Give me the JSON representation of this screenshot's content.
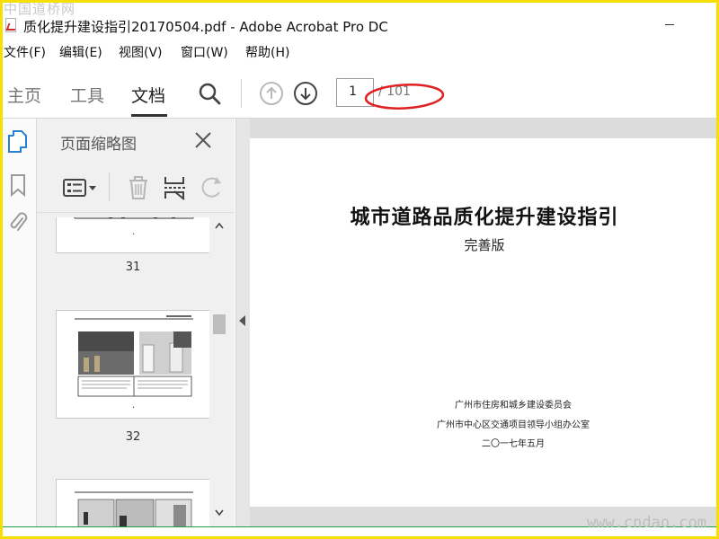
{
  "watermarks": {
    "top": "中国道桥网",
    "bottom": "www.cndao.com"
  },
  "window": {
    "title": "质化提升建设指引20170504.pdf - Adobe Acrobat Pro DC"
  },
  "menu": [
    "文件(F)",
    "编辑(E)",
    "视图(V)",
    "窗口(W)",
    "帮助(H)"
  ],
  "toolbar": {
    "tabs": [
      "主页",
      "工具",
      "文档"
    ],
    "active_tab": "文档",
    "page_current": "1",
    "page_total": "/ 101"
  },
  "panel": {
    "title": "页面缩略图",
    "thumbnails": [
      {
        "page": "31",
        "dot": "."
      },
      {
        "page": "32",
        "dot": "."
      }
    ]
  },
  "document": {
    "title": "城市道路品质化提升建设指引",
    "subtitle": "完善版",
    "org_lines": [
      "广州市住房和城乡建设委员会",
      "广州市中心区交通项目领导小组办公室",
      "二〇一七年五月"
    ]
  },
  "colors": {
    "frame": "#f5e000",
    "annotation": "#e02020",
    "rail_active": "#2b7fcf",
    "status_line": "#1f9e4a"
  },
  "icons": [
    "pdf-file-icon",
    "search-icon",
    "previous-page-icon",
    "next-page-icon",
    "thumbnails-icon",
    "bookmark-icon",
    "attachment-icon",
    "close-icon",
    "thumbnail-options-icon",
    "delete-page-icon",
    "insert-page-icon",
    "rotate-icon"
  ]
}
